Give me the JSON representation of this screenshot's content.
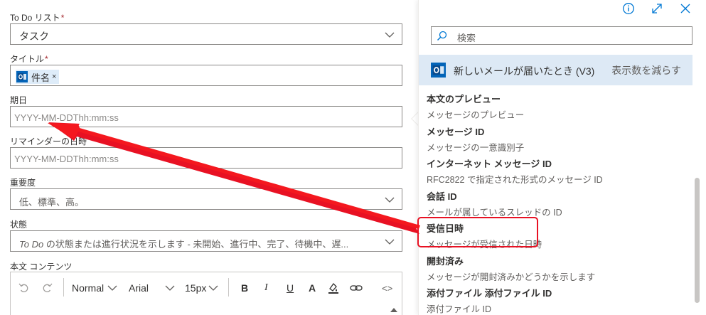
{
  "form": {
    "todo_list_label": "To Do リスト",
    "todo_list_value": "タスク",
    "title_label": "タイトル",
    "title_token": "件名",
    "title_token_remove": "×",
    "due_label": "期日",
    "due_placeholder": "YYYY-MM-DDThh:mm:ss",
    "reminder_label": "リマインダーの日時",
    "reminder_placeholder": "YYYY-MM-DDThh:mm:ss",
    "importance_label": "重要度",
    "importance_placeholder": "低、標準、高。",
    "status_label": "状態",
    "status_placeholder_prefix": "To Do",
    "status_placeholder_rest": " の状態または進行状況を示します - 未開始、進行中、完了、待機中、遅...",
    "body_label": "本文 コンテンツ",
    "required_mark": "*"
  },
  "editor_toolbar": {
    "format": "Normal",
    "font": "Arial",
    "size": "15px",
    "bold": "B",
    "italic": "I",
    "underline": "U",
    "font_color": "A",
    "code": "<>"
  },
  "panel": {
    "search_placeholder": "検索",
    "trigger_title": "新しいメールが届いたとき (V3)",
    "show_less": "表示数を減らす",
    "items": [
      {
        "name": "本文のプレビュー",
        "desc": "メッセージのプレビュー"
      },
      {
        "name": "メッセージ ID",
        "desc": "メッセージの一意識別子"
      },
      {
        "name": "インターネット メッセージ ID",
        "desc": "RFC2822 で指定された形式のメッセージ ID"
      },
      {
        "name": "会話 ID",
        "desc": "メールが属しているスレッドの ID"
      },
      {
        "name": "受信日時",
        "desc": "メッセージが受信された日時"
      },
      {
        "name": "開封済み",
        "desc": "メッセージが開封済みかどうかを示します"
      },
      {
        "name": "添付ファイル 添付ファイル ID",
        "desc": "添付ファイル ID"
      }
    ]
  },
  "colors": {
    "accent": "#0078d4",
    "outlook": "#0364b8",
    "highlight": "#e81123",
    "trigger_bg": "#dde9f5"
  },
  "icons": [
    "outlook-icon",
    "info-icon",
    "expand-icon",
    "close-icon",
    "search-icon",
    "chevron-down-icon",
    "undo-icon",
    "redo-icon",
    "highlight-icon",
    "link-icon"
  ]
}
